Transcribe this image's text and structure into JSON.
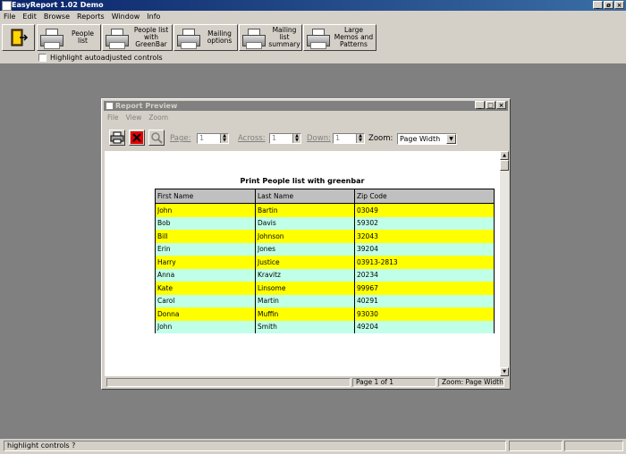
{
  "app": {
    "title": "EasyReport 1.02 Demo",
    "window_buttons": [
      "_",
      "ø",
      "×"
    ]
  },
  "menu": [
    "File",
    "Edit",
    "Browse",
    "Reports",
    "Window",
    "Info"
  ],
  "toolbar": {
    "buttons": [
      {
        "label": "People list"
      },
      {
        "label": "People list with GreenBar"
      },
      {
        "label": "Mailing options"
      },
      {
        "label": "Mailing list summary"
      },
      {
        "label": "Large Memos and Patterns"
      }
    ],
    "checkbox_label": "Highlight autoadjusted controls"
  },
  "report_window": {
    "title": "Report Preview",
    "menu": [
      "File",
      "View",
      "Zoom"
    ],
    "page_label": "Page:",
    "page_value": "1",
    "across_label": "Across:",
    "across_value": "1",
    "down_label": "Down:",
    "down_value": "1",
    "zoom_label": "Zoom:",
    "zoom_value": "Page Width",
    "status_page": "Page 1 of 1",
    "status_zoom": "Zoom: Page Width",
    "colors": {
      "band_a": "#ffff00",
      "band_b": "#c0ffe8"
    }
  },
  "report": {
    "title": "Print People list with greenbar",
    "columns": [
      "First Name",
      "Last Name",
      "Zip Code"
    ],
    "rows": [
      [
        "John",
        "Bartin",
        "03049"
      ],
      [
        "Bob",
        "Davis",
        "59302"
      ],
      [
        "Bill",
        "Johnson",
        "32043"
      ],
      [
        "Erin",
        "Jones",
        "39204"
      ],
      [
        "Harry",
        "Justice",
        "03913-2813"
      ],
      [
        "Anna",
        "Kravitz",
        "20234"
      ],
      [
        "Kate",
        "Linsome",
        "99967"
      ],
      [
        "Carol",
        "Martin",
        "40291"
      ],
      [
        "Donna",
        "Muffin",
        "93030"
      ],
      [
        "John",
        "Smith",
        "49204"
      ]
    ]
  },
  "statusbar": {
    "text": "highlight controls ?"
  }
}
